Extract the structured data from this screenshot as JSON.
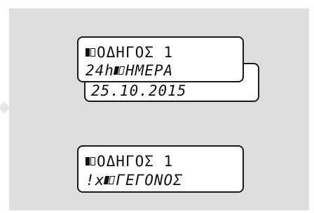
{
  "screen_1": {
    "line_1_text": "ΟΔΗΓΟΣ 1",
    "line_2_prefix": "24h",
    "line_2_text": "ΗΜΕΡΑ",
    "line_3_text": "25.10.2015"
  },
  "screen_2": {
    "line_1_text": "ΟΔΗΓΟΣ 1",
    "line_2_prefix": "!x",
    "line_2_text": "ΓΕΓΟΝΟΣ"
  }
}
